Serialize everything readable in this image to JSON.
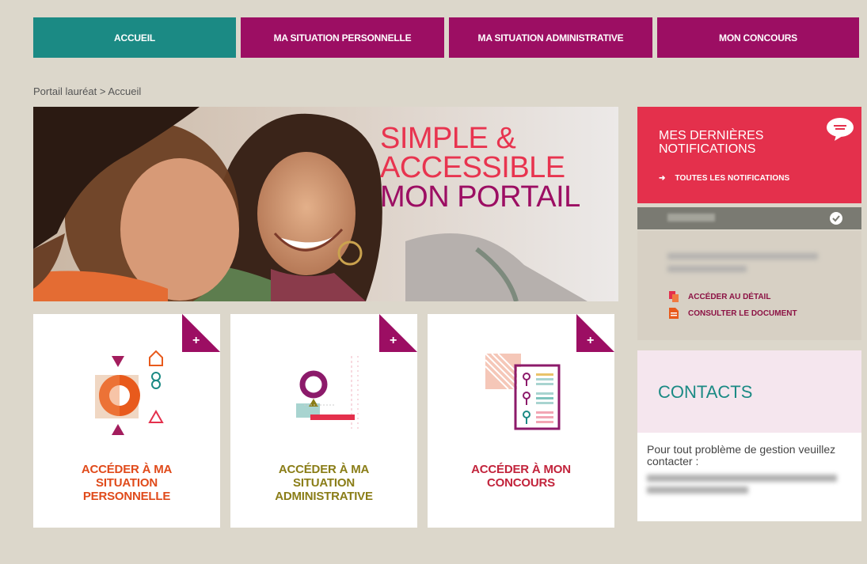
{
  "nav": {
    "tabs": [
      {
        "label": "ACCUEIL"
      },
      {
        "label": "MA SITUATION PERSONNELLE"
      },
      {
        "label": "MA SITUATION ADMINISTRATIVE"
      },
      {
        "label": "MON CONCOURS"
      }
    ],
    "colors": {
      "active": "#1b8a84",
      "inactive": "#9c0e63"
    }
  },
  "breadcrumb": {
    "parent": "Portail lauréat",
    "separator": " > ",
    "current": "Accueil"
  },
  "hero": {
    "line1": "SIMPLE &",
    "line2": "ACCESSIBLE",
    "line3": "MON PORTAIL"
  },
  "tiles": [
    {
      "label_line1": "ACCÉDER À MA",
      "label_line2": "SITUATION",
      "label_line3": "PERSONNELLE",
      "icon": "plus-icon"
    },
    {
      "label_line1": "ACCÉDER À MA",
      "label_line2": "SITUATION",
      "label_line3": "ADMINISTRATIVE",
      "icon": "plus-icon"
    },
    {
      "label_line1": "ACCÉDER À MON",
      "label_line2": "CONCOURS",
      "label_line3": "",
      "icon": "plus-icon"
    }
  ],
  "notifications": {
    "title": "MES DERNIÈRES NOTIFICATIONS",
    "all_link": "TOUTES LES NOTIFICATIONS",
    "detail_link": "ACCÉDER AU DÉTAIL",
    "document_link": "CONSULTER LE DOCUMENT",
    "color": "#e4304c"
  },
  "contacts": {
    "title": "CONTACTS",
    "text": "Pour tout problème de gestion veuillez contacter :"
  }
}
